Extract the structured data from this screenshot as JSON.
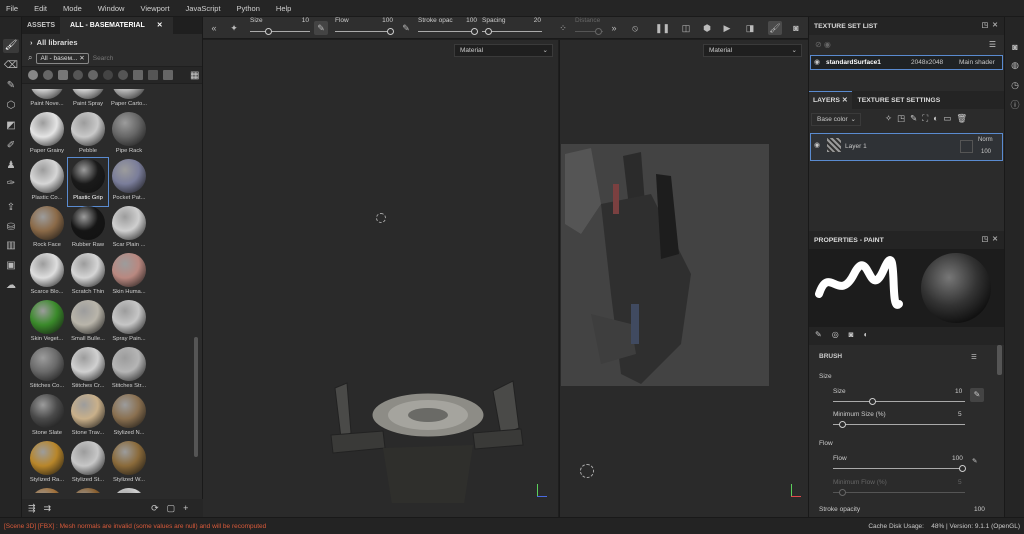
{
  "menu": [
    "File",
    "Edit",
    "Mode",
    "Window",
    "Viewport",
    "JavaScript",
    "Python",
    "Help"
  ],
  "assets": {
    "tab1": "ASSETS",
    "tab2": "ALL - BASEMATERIAL",
    "all_libraries": "All libraries",
    "filter_chip": "All - baseм...",
    "search_placeholder": "Search",
    "items": [
      {
        "label": "Paint Nove...",
        "color": "#cfcfcf"
      },
      {
        "label": "Paint Spray",
        "color": "#d0d0d0"
      },
      {
        "label": "Paper Carto...",
        "color": "#bcbcbc"
      },
      {
        "label": "Paper Grainy",
        "color": "#e4e4e4"
      },
      {
        "label": "Pebble",
        "color": "#c9c9c9"
      },
      {
        "label": "Pipe Rack",
        "color": "#666"
      },
      {
        "label": "Plastic Co...",
        "color": "#d6d6d6"
      },
      {
        "label": "Plastic Grip",
        "color": "#1a1a1a"
      },
      {
        "label": "Pocket Pat...",
        "color": "#7a7d9a"
      },
      {
        "label": "Rock Face",
        "color": "#8b6a48"
      },
      {
        "label": "Rubber Raw",
        "color": "#151515"
      },
      {
        "label": "Scar Plain ...",
        "color": "#cfcfcf"
      },
      {
        "label": "Scarce Blo...",
        "color": "#dedede"
      },
      {
        "label": "Scratch Thin",
        "color": "#d5d5d5"
      },
      {
        "label": "Skin Huma...",
        "color": "#b98880"
      },
      {
        "label": "Skin Veget...",
        "color": "#3a8a2a"
      },
      {
        "label": "Small Bulle...",
        "color": "#b9b5aa"
      },
      {
        "label": "Spray Pain...",
        "color": "#c6c6c6"
      },
      {
        "label": "Stitches Co...",
        "color": "#6a6a6a"
      },
      {
        "label": "Stitches Cr...",
        "color": "#d0d0d0"
      },
      {
        "label": "Stitches Str...",
        "color": "#b5b5b5"
      },
      {
        "label": "Stone Slate",
        "color": "#4a4a4a"
      },
      {
        "label": "Stone Trav...",
        "color": "#c9b08a"
      },
      {
        "label": "Stylized N...",
        "color": "#8a7050"
      },
      {
        "label": "Stylized Ra...",
        "color": "#b8862a"
      },
      {
        "label": "Stylized St...",
        "color": "#c7c7c7"
      },
      {
        "label": "Stylized W...",
        "color": "#8a6a3a"
      },
      {
        "label": "",
        "color": "#a0703a"
      },
      {
        "label": "",
        "color": "#8a6030"
      },
      {
        "label": "",
        "color": "#d0d0d0"
      }
    ]
  },
  "toolbar": {
    "size_label": "Size",
    "size_value": "10",
    "flow_label": "Flow",
    "flow_value": "100",
    "stroke_label": "Stroke opac",
    "stroke_value": "100",
    "spacing_label": "Spacing",
    "spacing_value": "20",
    "distance_label": "Distance"
  },
  "viewport": {
    "left_mode": "Material",
    "right_mode": "Material"
  },
  "texture_set": {
    "title": "TEXTURE SET LIST",
    "name": "standardSurface1",
    "size": "2048x2048",
    "shader": "Main shader"
  },
  "layers": {
    "tab1": "LAYERS",
    "tab2": "TEXTURE SET SETTINGS",
    "channel": "Base color",
    "layer_name": "Layer 1",
    "blend": "Norm",
    "opacity": "100"
  },
  "properties": {
    "title": "PROPERTIES - PAINT",
    "brush_header": "BRUSH",
    "size_group": "Size",
    "size_label": "Size",
    "size_value": "10",
    "min_size_label": "Minimum Size (%)",
    "min_size_value": "5",
    "flow_group": "Flow",
    "flow_label": "Flow",
    "flow_value": "100",
    "min_flow_label": "Minimum Flow (%)",
    "min_flow_value": "5",
    "stroke_label": "Stroke opacity",
    "stroke_value": "100"
  },
  "status": {
    "error": "[Scene 3D] [FBX] : Mesh normals are invalid (some values are null) and will be recomputed",
    "cache_label": "Cache Disk Usage:",
    "cache_value": "48%",
    "version": "| Version: 9.1.1 (OpenGL)"
  }
}
